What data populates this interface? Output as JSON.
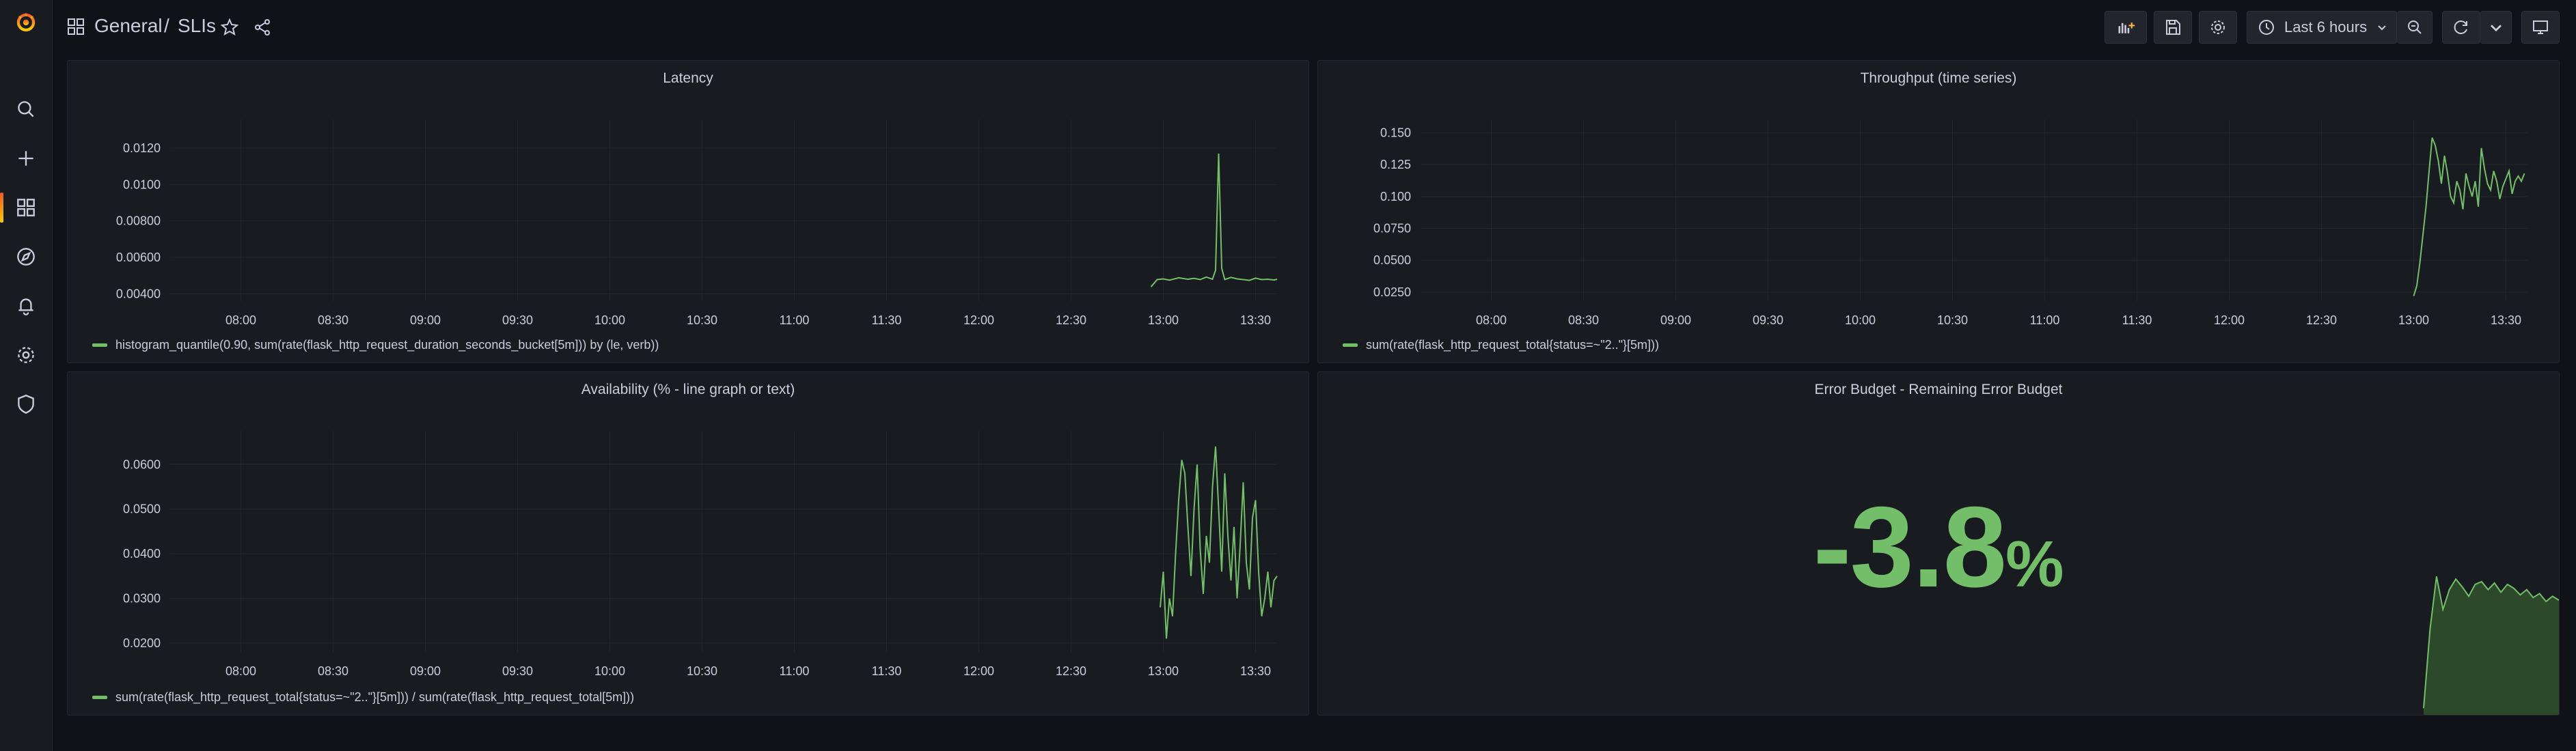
{
  "header": {
    "folder": "General",
    "separator": "/",
    "dashboard": "SLIs",
    "time_range": "Last 6 hours"
  },
  "sidebar": {
    "items": [
      "grafana-logo",
      "search-icon",
      "plus-icon",
      "dashboards-icon",
      "explore-icon",
      "alerting-icon",
      "configuration-icon",
      "shield-icon"
    ]
  },
  "colors": {
    "series": "#73bf69",
    "panel_bg": "#181b1f",
    "page_bg": "#111217"
  },
  "panels": {
    "latency": {
      "title": "Latency",
      "legend": "histogram_quantile(0.90, sum(rate(flask_http_request_duration_seconds_bucket[5m])) by (le, verb))"
    },
    "throughput": {
      "title": "Throughput (time series)",
      "legend": "sum(rate(flask_http_request_total{status=~\"2..\"}[5m]))"
    },
    "availability": {
      "title": "Availability (% - line graph or text)",
      "legend": "sum(rate(flask_http_request_total{status=~\"2..\"}[5m])) / sum(rate(flask_http_request_total[5m]))"
    },
    "error_budget": {
      "title": "Error Budget - Remaining Error Budget",
      "value": "-3.8",
      "unit": "%"
    }
  },
  "chart_data": [
    {
      "type": "line",
      "title": "Latency",
      "x_ticks": [
        "08:00",
        "08:30",
        "09:00",
        "09:30",
        "10:00",
        "10:30",
        "11:00",
        "11:30",
        "12:00",
        "12:30",
        "13:00",
        "13:30"
      ],
      "y_ticks": [
        "0.00400",
        "0.00600",
        "0.00800",
        "0.0100",
        "0.0120"
      ],
      "ylim": [
        0.0036,
        0.0132
      ],
      "series": [
        {
          "name": "histogram_quantile(0.90, sum(rate(flask_http_request_duration_seconds_bucket[5m])) by (le, verb))",
          "x": [
            "12:56",
            "12:58",
            "13:00",
            "13:02",
            "13:05",
            "13:08",
            "13:10",
            "13:12",
            "13:14",
            "13:16",
            "13:17",
            "13:18",
            "13:19",
            "13:20",
            "13:22",
            "13:24",
            "13:26",
            "13:28",
            "13:30",
            "13:32",
            "13:34",
            "13:36",
            "13:37"
          ],
          "values": [
            0.00438,
            0.00478,
            0.00482,
            0.00475,
            0.00488,
            0.0048,
            0.00485,
            0.00478,
            0.00492,
            0.0048,
            0.0053,
            0.0117,
            0.0054,
            0.00478,
            0.0049,
            0.00482,
            0.00478,
            0.00474,
            0.00486,
            0.00478,
            0.0048,
            0.00476,
            0.0048
          ]
        }
      ]
    },
    {
      "type": "line",
      "title": "Throughput (time series)",
      "x_ticks": [
        "08:00",
        "08:30",
        "09:00",
        "09:30",
        "10:00",
        "10:30",
        "11:00",
        "11:30",
        "12:00",
        "12:30",
        "13:00",
        "13:30"
      ],
      "y_ticks": [
        "0.0250",
        "0.0500",
        "0.0750",
        "0.100",
        "0.125",
        "0.150"
      ],
      "ylim": [
        0.018,
        0.155
      ],
      "series": [
        {
          "name": "sum(rate(flask_http_request_total{status=~\"2..\"}[5m]))",
          "x": [
            "13:00",
            "13:01",
            "13:02",
            "13:03",
            "13:04",
            "13:05",
            "13:06",
            "13:07",
            "13:08",
            "13:09",
            "13:10",
            "13:11",
            "13:12",
            "13:13",
            "13:14",
            "13:15",
            "13:16",
            "13:17",
            "13:18",
            "13:19",
            "13:20",
            "13:21",
            "13:22",
            "13:23",
            "13:24",
            "13:25",
            "13:26",
            "13:27",
            "13:28",
            "13:29",
            "13:30",
            "13:31",
            "13:32",
            "13:33",
            "13:34",
            "13:35",
            "13:36"
          ],
          "values": [
            0.022,
            0.03,
            0.048,
            0.07,
            0.092,
            0.12,
            0.146,
            0.14,
            0.128,
            0.11,
            0.132,
            0.118,
            0.1,
            0.095,
            0.112,
            0.105,
            0.09,
            0.118,
            0.108,
            0.1,
            0.112,
            0.092,
            0.138,
            0.122,
            0.11,
            0.105,
            0.12,
            0.112,
            0.098,
            0.108,
            0.114,
            0.12,
            0.102,
            0.112,
            0.116,
            0.112,
            0.118
          ]
        }
      ]
    },
    {
      "type": "line",
      "title": "Availability (% - line graph or text)",
      "x_ticks": [
        "08:00",
        "08:30",
        "09:00",
        "09:30",
        "10:00",
        "10:30",
        "11:00",
        "11:30",
        "12:00",
        "12:30",
        "13:00",
        "13:30"
      ],
      "y_ticks": [
        "0.0200",
        "0.0300",
        "0.0400",
        "0.0500",
        "0.0600"
      ],
      "ylim": [
        0.018,
        0.066
      ],
      "series": [
        {
          "name": "sum(rate(flask_http_request_total{status=~\"2..\"}[5m])) / sum(rate(flask_http_request_total[5m]))",
          "x": [
            "12:59",
            "13:00",
            "13:01",
            "13:02",
            "13:03",
            "13:04",
            "13:05",
            "13:06",
            "13:07",
            "13:08",
            "13:09",
            "13:10",
            "13:11",
            "13:12",
            "13:13",
            "13:14",
            "13:15",
            "13:16",
            "13:17",
            "13:18",
            "13:19",
            "13:20",
            "13:21",
            "13:22",
            "13:23",
            "13:24",
            "13:25",
            "13:26",
            "13:27",
            "13:28",
            "13:29",
            "13:30",
            "13:31",
            "13:32",
            "13:33",
            "13:34",
            "13:35",
            "13:36",
            "13:37"
          ],
          "values": [
            0.028,
            0.036,
            0.021,
            0.03,
            0.026,
            0.04,
            0.052,
            0.061,
            0.058,
            0.046,
            0.035,
            0.05,
            0.06,
            0.041,
            0.031,
            0.044,
            0.038,
            0.055,
            0.064,
            0.05,
            0.036,
            0.058,
            0.044,
            0.034,
            0.046,
            0.03,
            0.042,
            0.056,
            0.038,
            0.032,
            0.048,
            0.052,
            0.036,
            0.026,
            0.03,
            0.036,
            0.028,
            0.034,
            0.035
          ]
        }
      ]
    }
  ],
  "error_budget_sparkline": {
    "values": [
      -12.0,
      -6.0,
      -2.0,
      -4.5,
      -3.0,
      -2.2,
      -2.8,
      -3.5,
      -2.6,
      -2.4,
      -3.0,
      -2.5,
      -3.2,
      -2.6,
      -2.9,
      -3.4,
      -3.0,
      -3.6,
      -3.3,
      -3.9,
      -3.5,
      -3.8
    ],
    "ylim": [
      -12.5,
      -1.0
    ]
  }
}
